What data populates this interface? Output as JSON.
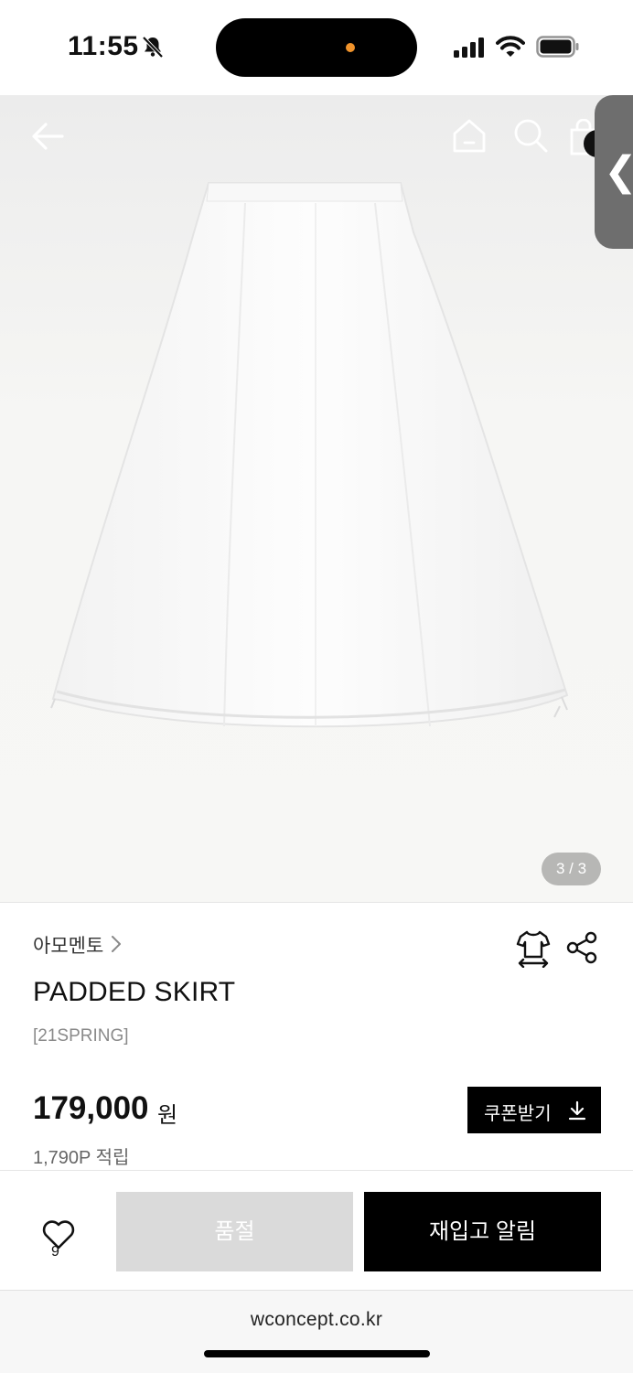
{
  "status_bar": {
    "time": "11:55"
  },
  "hero": {
    "image_counter": "3 / 3",
    "icons": [
      "back-arrow-icon",
      "home-icon",
      "search-icon",
      "cart-icon",
      "chevron-left-icon"
    ]
  },
  "product": {
    "brand": "아모멘토",
    "name": "PADDED SKIRT",
    "season": "[21SPRING]",
    "price": "179,000",
    "price_unit": "원",
    "points": "1,790P 적립",
    "coupon_label": "쿠폰받기"
  },
  "bottom_bar": {
    "like_count": "9",
    "soldout_label": "품절",
    "restock_label": "재입고 알림"
  },
  "browser": {
    "url": "wconcept.co.kr"
  }
}
